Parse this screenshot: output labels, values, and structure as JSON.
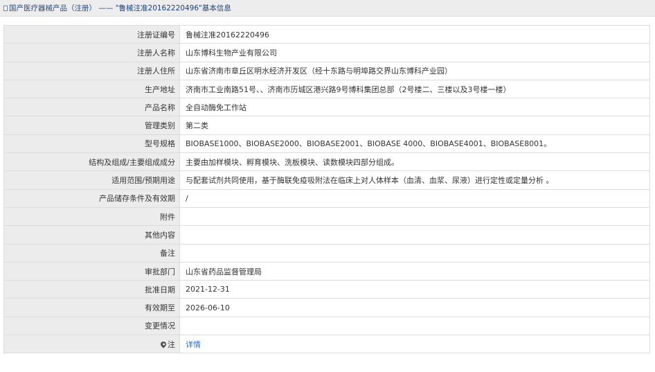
{
  "breadcrumb": {
    "root_label": "国产医疗器械产品（注册）",
    "separator": " —— ",
    "current_label": "\"鲁械注准20162220496\"基本信息"
  },
  "rows": [
    {
      "label": "注册证编号",
      "value": "鲁械注准20162220496"
    },
    {
      "label": "注册人名称",
      "value": "山东博科生物产业有限公司"
    },
    {
      "label": "注册人住所",
      "value": "山东省济南市章丘区明水经济开发区（经十东路与明埠路交界山东博科产业园）"
    },
    {
      "label": "生产地址",
      "value": "济南市工业南路51号、、济南市历城区港兴路9号博科集团总部（2号楼二、三楼以及3号楼一楼）"
    },
    {
      "label": "产品名称",
      "value": "全自动酶免工作站"
    },
    {
      "label": "管理类别",
      "value": "第二类"
    },
    {
      "label": "型号规格",
      "value": "BIOBASE1000、BIOBASE2000、BIOBASE2001、BIOBASE 4000、BIOBASE4001、BIOBASE8001。"
    },
    {
      "label": "结构及组成/主要组成成分",
      "value": "主要由加样模块、孵育模块、洗板模块、读数模块四部分组成。"
    },
    {
      "label": "适用范围/预期用途",
      "value": "与配套试剂共同使用，基于酶联免疫吸附法在临床上对人体样本（血清、血浆、尿液）进行定性或定量分析 。"
    },
    {
      "label": "产品储存条件及有效期",
      "value": "/"
    },
    {
      "label": "附件",
      "value": ""
    },
    {
      "label": "其他内容",
      "value": ""
    },
    {
      "label": "备注",
      "value": ""
    },
    {
      "label": "审批部门",
      "value": "山东省药品监督管理局"
    },
    {
      "label": "批准日期",
      "value": "2021-12-31"
    },
    {
      "label": "有效期至",
      "value": "2026-06-10"
    },
    {
      "label": "变更情况",
      "value": ""
    }
  ],
  "note_row": {
    "label": "注",
    "link_text": "详情",
    "icon": "map-pin-icon"
  },
  "colors": {
    "label_bg": "#ececec",
    "border": "#dcdcdc",
    "link": "#2c6bb8",
    "breadcrumb_text": "#2a4a7d"
  }
}
